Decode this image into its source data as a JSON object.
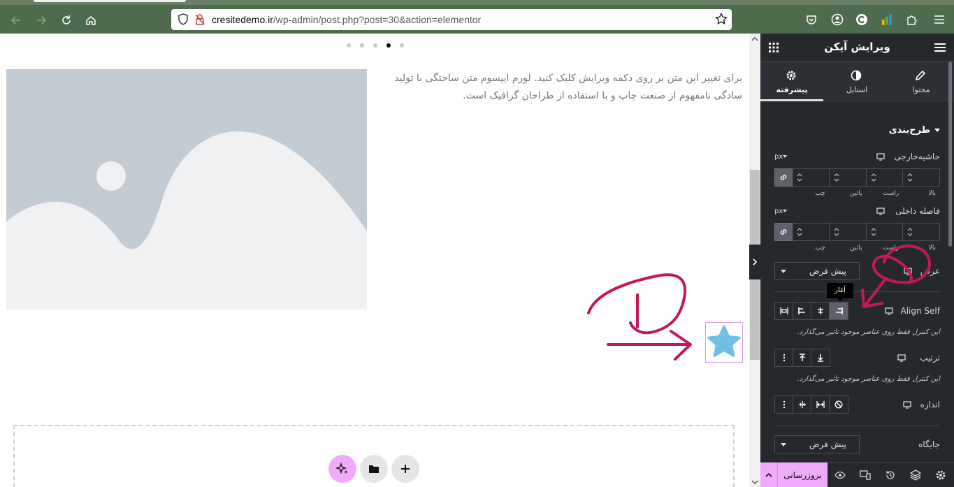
{
  "browser": {
    "url_host": "cresitedemo.ir",
    "url_path": "/wp-admin/post.php?post=30&action=elementor"
  },
  "canvas": {
    "paragraph": "برای تغییر این متن بر روی دکمه ویرایش کلیک کنید. لورم ایپسوم متن ساختگی با تولید سادگی نامفهوم از صنعت چاپ و با استفاده از طراحان گرافیک است.",
    "slider_dots": 5,
    "active_dot": 4
  },
  "panel": {
    "title": "ویرایش آیکن",
    "tabs": [
      {
        "label": "محتوا",
        "icon": "pencil-icon"
      },
      {
        "label": "استایل",
        "icon": "half-circle-icon"
      },
      {
        "label": "پیشرفته",
        "icon": "gear-icon",
        "active": true
      }
    ],
    "section": "طرح‌بندی",
    "margin": {
      "label": "حاشیه‌خارجی",
      "unit": "px"
    },
    "padding": {
      "label": "فاصله داخلی",
      "unit": "px"
    },
    "dim_labels": [
      "چپ",
      "پائین",
      "راست",
      "بالا"
    ],
    "width": {
      "label": "عرض",
      "value": "پیش فرض"
    },
    "tooltip": "آغاز",
    "align_self": {
      "label": "Align Self"
    },
    "hint": "این کنترل فقط روی عناصر موجود تاثیر می‌گذارد.",
    "order": {
      "label": "ترتیب"
    },
    "size": {
      "label": "اندازه"
    },
    "position": {
      "label": "جایگاه",
      "value": "پیش فرض"
    },
    "footer": {
      "update": "بروزرسانی"
    }
  },
  "colors": {
    "accent": "#f0abfc",
    "annotation": "#c2185b",
    "star": "#6ec1e4"
  }
}
